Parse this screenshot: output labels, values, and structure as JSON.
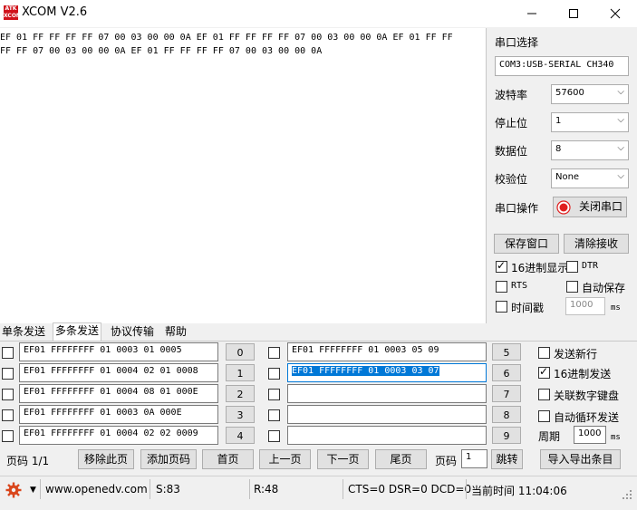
{
  "window": {
    "logo_text": "ATK XCOM",
    "title": "XCOM V2.6",
    "minimize_icon": "minimize-icon",
    "maximize_icon": "maximize-icon",
    "close_icon": "close-icon"
  },
  "receive": {
    "text": "EF 01 FF FF FF FF 07 00 03 00 00 0A EF 01 FF FF FF FF 07 00 03 00 00 0A EF 01 FF FF\nFF FF 07 00 03 00 00 0A EF 01 FF FF FF FF 07 00 03 00 00 0A"
  },
  "port_panel": {
    "port_select_label": "串口选择",
    "port_value": "COM3:USB-SERIAL CH340",
    "baud_label": "波特率",
    "baud_value": "57600",
    "stop_label": "停止位",
    "stop_value": "1",
    "data_label": "数据位",
    "data_value": "8",
    "parity_label": "校验位",
    "parity_value": "None",
    "op_label": "串口操作",
    "op_button": "关闭串口",
    "save_window": "保存窗口",
    "clear_receive": "清除接收",
    "hex_display": "16进制显示",
    "hex_display_checked": true,
    "dtr": "DTR",
    "dtr_checked": false,
    "rts": "RTS",
    "rts_checked": false,
    "auto_save": "自动保存",
    "auto_save_checked": false,
    "timestamp": "时间戳",
    "timestamp_checked": false,
    "timestamp_value": "1000",
    "ms": "ms"
  },
  "tabs": [
    {
      "label": "单条发送"
    },
    {
      "label": "多条发送"
    },
    {
      "label": "协议传输"
    },
    {
      "label": "帮助"
    }
  ],
  "multi_send": {
    "left_rows": [
      {
        "text": "EF01 FFFFFFFF 01 0003 01 0005",
        "num": "0"
      },
      {
        "text": "EF01 FFFFFFFF 01 0004 02 01 0008",
        "num": "1"
      },
      {
        "text": "EF01 FFFFFFFF 01 0004 08 01 000E",
        "num": "2"
      },
      {
        "text": "EF01 FFFFFFFF 01 0003 0A 000E",
        "num": "3"
      },
      {
        "text": "EF01 FFFFFFFF 01 0004 02 02 0009",
        "num": "4"
      }
    ],
    "right_rows": [
      {
        "text": "EF01 FFFFFFFF 01 0003 05 09",
        "num": "5"
      },
      {
        "text": "EF01 FFFFFFFF 01 0003 03 07",
        "num": "6"
      },
      {
        "text": "",
        "num": "7"
      },
      {
        "text": "",
        "num": "8"
      },
      {
        "text": "",
        "num": "9"
      }
    ],
    "options": {
      "send_newline": "发送新行",
      "send_newline_checked": false,
      "hex_send": "16进制发送",
      "hex_send_checked": true,
      "linked_keyboard": "关联数字键盘",
      "linked_keyboard_checked": false,
      "auto_loop": "自动循环发送",
      "auto_loop_checked": false,
      "period_label": "周期",
      "period_value": "1000",
      "ms": "ms"
    },
    "page_label": "页码 1/1",
    "remove_page": "移除此页",
    "add_page": "添加页码",
    "first_page": "首页",
    "prev_page": "上一页",
    "next_page": "下一页",
    "last_page": "尾页",
    "page_input_label": "页码",
    "page_input_value": "1",
    "jump": "跳转",
    "import_export": "导入导出条目"
  },
  "status": {
    "gear_icon": "gear-icon",
    "website": "www.openedv.com",
    "sent": "S:83",
    "received": "R:48",
    "signals": "CTS=0 DSR=0 DCD=0",
    "time": "当前时间 11:04:06"
  }
}
